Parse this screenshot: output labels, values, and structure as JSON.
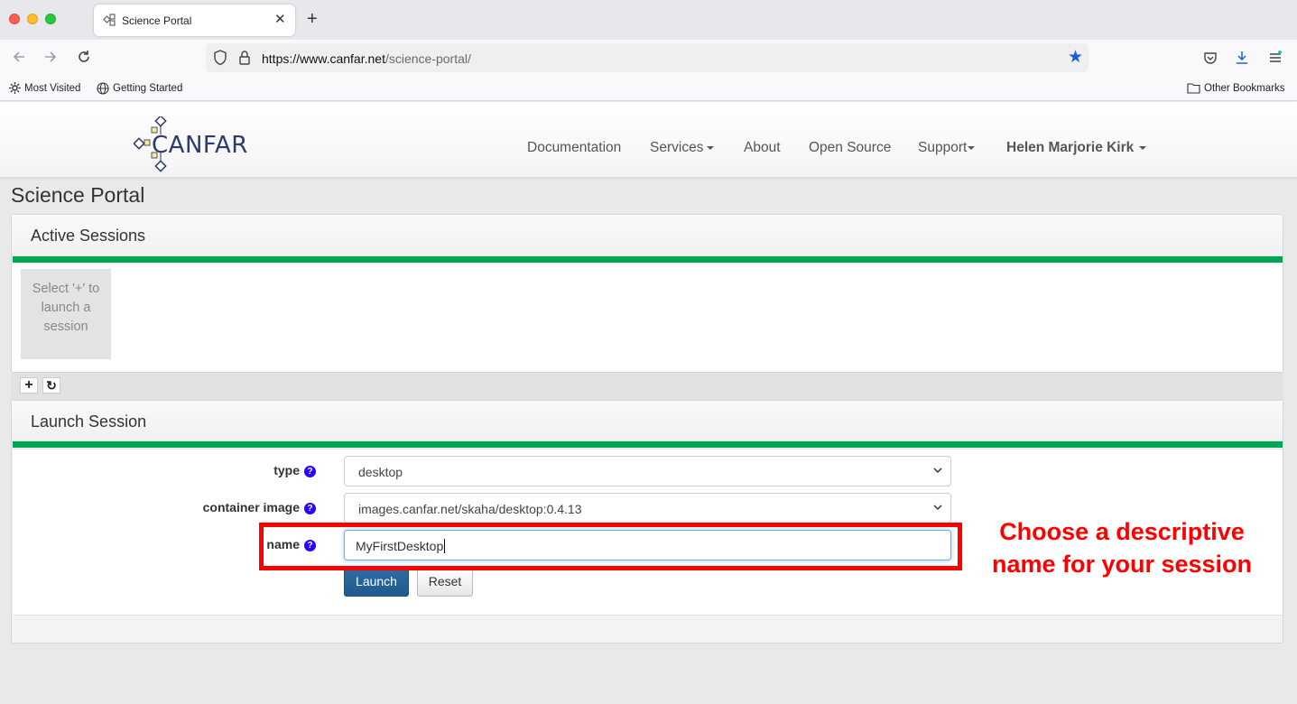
{
  "browser": {
    "tab_title": "Science Portal",
    "tab_close": "✕",
    "new_tab": "+",
    "url_host": "https://www.canfar.net",
    "url_path": "/science-portal/",
    "bookmarks": [
      "Most Visited",
      "Getting Started"
    ],
    "other_bookmarks": "Other Bookmarks"
  },
  "site": {
    "logo_text": "CANFAR",
    "nav": {
      "documentation": "Documentation",
      "services": "Services",
      "about": "About",
      "open_source": "Open Source",
      "support": "Support",
      "user": "Helen Marjorie Kirk"
    }
  },
  "page": {
    "title": "Science Portal"
  },
  "active_sessions": {
    "title": "Active Sessions",
    "placeholder": "Select '+' to launch a session",
    "add_glyph": "+",
    "refresh_glyph": "↻"
  },
  "launch_session": {
    "title": "Launch Session",
    "fields": {
      "type_label": "type",
      "type_value": "desktop",
      "image_label": "container image",
      "image_value": "images.canfar.net/skaha/desktop:0.4.13",
      "name_label": "name",
      "name_value": "MyFirstDesktop"
    },
    "help_glyph": "?",
    "launch_label": "Launch",
    "reset_label": "Reset"
  },
  "annotation": {
    "text": "Choose a descriptive name for your session",
    "color": "#ff0000"
  },
  "colors": {
    "accent_green": "#00a651",
    "launch_blue": "#1f5a8f",
    "help_icon": "#2a00ff"
  }
}
